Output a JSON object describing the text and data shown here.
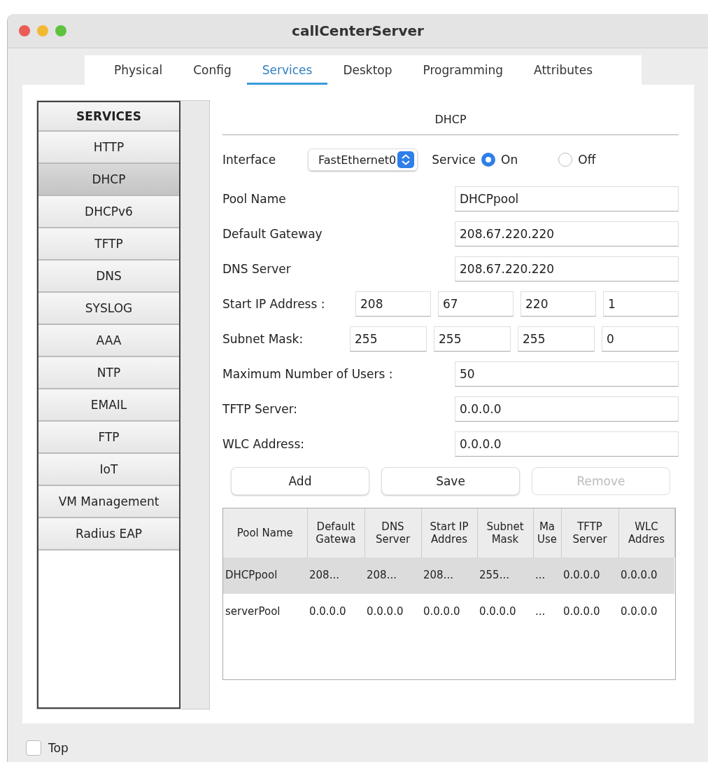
{
  "window": {
    "title": "callCenterServer"
  },
  "tabs": [
    {
      "label": "Physical",
      "selected": false
    },
    {
      "label": "Config",
      "selected": false
    },
    {
      "label": "Services",
      "selected": true
    },
    {
      "label": "Desktop",
      "selected": false
    },
    {
      "label": "Programming",
      "selected": false
    },
    {
      "label": "Attributes",
      "selected": false
    }
  ],
  "sidebar": {
    "heading": "SERVICES",
    "items": [
      {
        "label": "HTTP",
        "selected": false
      },
      {
        "label": "DHCP",
        "selected": true
      },
      {
        "label": "DHCPv6",
        "selected": false
      },
      {
        "label": "TFTP",
        "selected": false
      },
      {
        "label": "DNS",
        "selected": false
      },
      {
        "label": "SYSLOG",
        "selected": false
      },
      {
        "label": "AAA",
        "selected": false
      },
      {
        "label": "NTP",
        "selected": false
      },
      {
        "label": "EMAIL",
        "selected": false
      },
      {
        "label": "FTP",
        "selected": false
      },
      {
        "label": "IoT",
        "selected": false
      },
      {
        "label": "VM Management",
        "selected": false
      },
      {
        "label": "Radius EAP",
        "selected": false
      }
    ]
  },
  "panel": {
    "title": "DHCP",
    "interface": {
      "label": "Interface",
      "value": "FastEthernet0"
    },
    "service": {
      "label": "Service",
      "options": [
        {
          "label": "On",
          "selected": true
        },
        {
          "label": "Off",
          "selected": false
        }
      ]
    },
    "fields": [
      {
        "label": "Pool Name",
        "value": "DHCPpool"
      },
      {
        "label": "Default Gateway",
        "value": "208.67.220.220"
      },
      {
        "label": "DNS Server",
        "value": "208.67.220.220"
      }
    ],
    "start_ip": {
      "label": "Start IP Address :",
      "octets": [
        "208",
        "67",
        "220",
        "1"
      ]
    },
    "subnet_mask": {
      "label": "Subnet Mask:",
      "octets": [
        "255",
        "255",
        "255",
        "0"
      ]
    },
    "fields_2": [
      {
        "label": "Maximum Number of Users :",
        "value": "50"
      },
      {
        "label": "TFTP Server:",
        "value": "0.0.0.0"
      },
      {
        "label": "WLC Address:",
        "value": "0.0.0.0"
      }
    ],
    "buttons": [
      {
        "label": "Add",
        "disabled": false
      },
      {
        "label": "Save",
        "disabled": false
      },
      {
        "label": "Remove",
        "disabled": true
      }
    ],
    "table": {
      "columns": [
        "Pool Name",
        "Default Gatewa",
        "DNS Server",
        "Start IP Addres",
        "Subnet Mask",
        "Ma Use",
        "TFTP Server",
        "WLC Addres"
      ],
      "rows": [
        {
          "selected": true,
          "cells": [
            "DHCPpool",
            "208...",
            "208...",
            "208...",
            "255...",
            "...",
            "0.0.0.0",
            "0.0.0.0"
          ]
        },
        {
          "selected": false,
          "cells": [
            "serverPool",
            "0.0.0.0",
            "0.0.0.0",
            "0.0.0.0",
            "0.0.0.0",
            "...",
            "0.0.0.0",
            "0.0.0.0"
          ]
        }
      ]
    }
  },
  "footer": {
    "checkbox": {
      "label": "Top",
      "checked": false
    }
  }
}
